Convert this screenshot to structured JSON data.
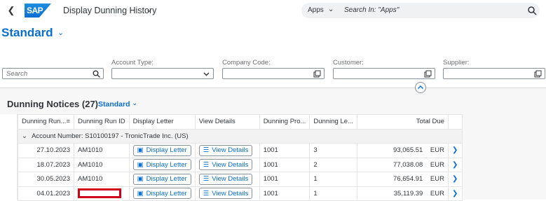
{
  "shell": {
    "app_title": "Display Dunning History",
    "search_scope": "Apps",
    "search_placeholder": "Search In: \"Apps\""
  },
  "variant": {
    "name": "Standard",
    "modified_marker": "*"
  },
  "filters": {
    "search_placeholder": "Search",
    "account_type_label": "Account Type:",
    "company_code_label": "Company Code:",
    "customer_label": "Customer:",
    "supplier_label": "Supplier:"
  },
  "table": {
    "title": "Dunning Notices (27)",
    "variant": "Standard",
    "columns": [
      "Dunning Run...",
      "Dunning Run ID",
      "Display Letter",
      "View Details",
      "Dunning Pro...",
      "Dunning Le...",
      "Total Due"
    ],
    "group_label": "Account Number: S10100197 - TronicTrade Inc. (US)",
    "button_display_letter": "Display Letter",
    "button_view_details": "View Details",
    "rows": [
      {
        "date": "27.10.2023",
        "run_id": "AM1010",
        "procedure": "1001",
        "level": "3",
        "total": "93,065.51",
        "currency": "EUR"
      },
      {
        "date": "18.07.2023",
        "run_id": "AM1010",
        "procedure": "1001",
        "level": "2",
        "total": "77,038.08",
        "currency": "EUR"
      },
      {
        "date": "30.05.2023",
        "run_id": "AM1010",
        "procedure": "1001",
        "level": "1",
        "total": "76,654.91",
        "currency": "EUR"
      },
      {
        "date": "04.01.2023",
        "run_id": "",
        "procedure": "1001",
        "level": "1",
        "total": "35,119.39",
        "currency": "EUR"
      }
    ]
  },
  "colors": {
    "accent": "#0a6ed1",
    "highlight_box": "#d0021b"
  }
}
